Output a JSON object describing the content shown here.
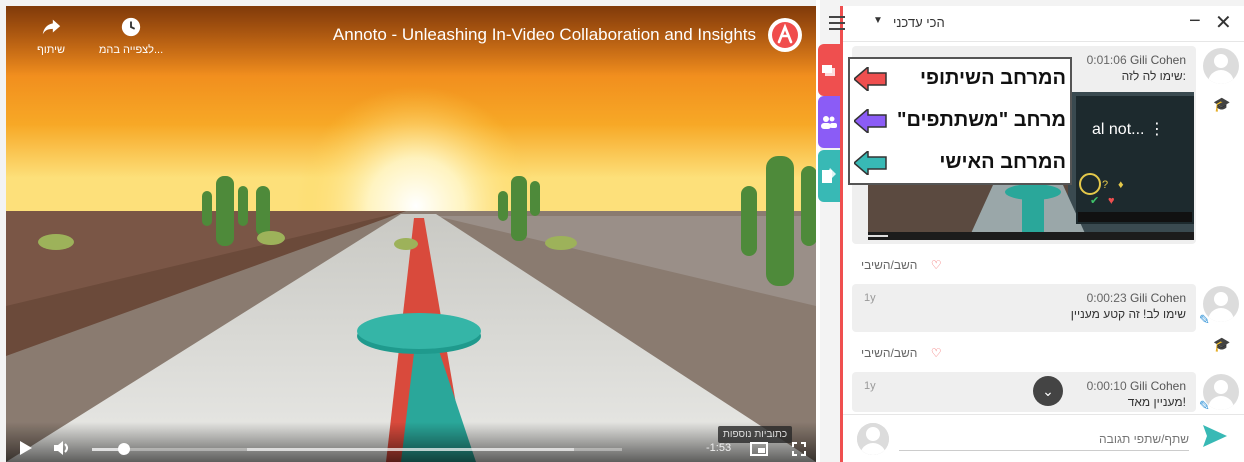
{
  "video": {
    "title": "Annoto - Unleashing In-Video Collaboration and Insights",
    "share_label": "שיתוף",
    "watch_later_label": "לצפייה בהמ...",
    "time_remaining": "-1:53",
    "tooltip": "כתוביות נוספות",
    "progress_fraction": 0.06
  },
  "panel": {
    "sort_label": "הכי עדכני",
    "reply_label": "השב/השיבי",
    "composer_placeholder": "שתף/שתפי תגובה",
    "comments": [
      {
        "author": "Gili Cohen",
        "timestamp": "0:01:06",
        "age": "",
        "text": "שימו לה לזה:"
      },
      {
        "author": "Gili Cohen",
        "timestamp": "0:00:23",
        "age": "1y",
        "text": "שימו לב! זה קטע מעניין"
      },
      {
        "author": "Gili Cohen",
        "timestamp": "0:00:10",
        "age": "1y",
        "text": "מעניין מאד!"
      }
    ],
    "thumb_text": "al not..."
  },
  "callout": {
    "shared": "המרחב השיתופי",
    "participants": "מרחב \"משתתפים\"",
    "personal": "המרחב האישי"
  },
  "colors": {
    "shared": "#ef4f4f",
    "participants": "#8b5cf6",
    "personal": "#38b9b5"
  }
}
